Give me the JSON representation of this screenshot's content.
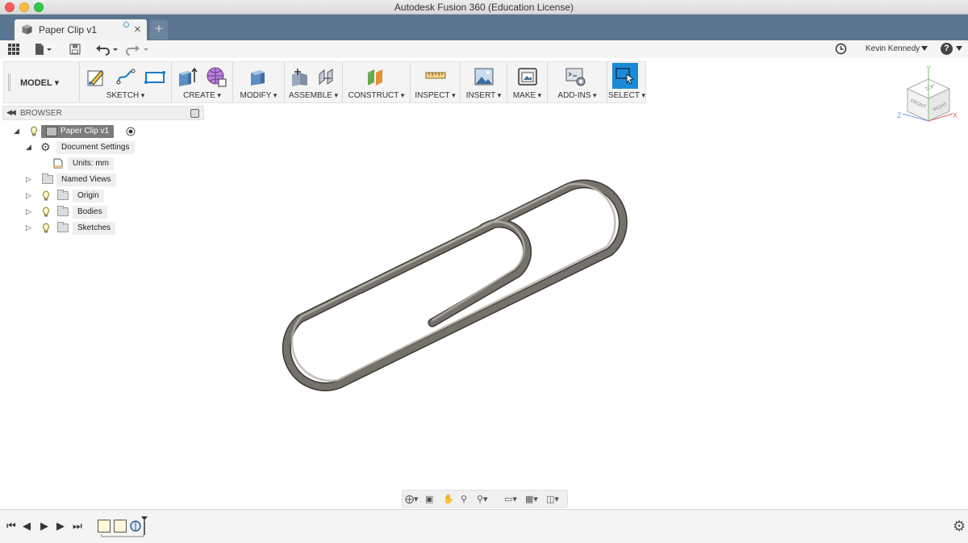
{
  "window": {
    "title": "Autodesk Fusion 360 (Education License)"
  },
  "tabs": {
    "active_label": "Paper Clip v1",
    "new_tab_symbol": "+",
    "close_symbol": "×"
  },
  "user": {
    "name": "Kevin Kennedy",
    "help": "?"
  },
  "workspace": {
    "label": "MODEL"
  },
  "toolbar": {
    "groups": [
      "SKETCH",
      "CREATE",
      "MODIFY",
      "ASSEMBLE",
      "CONSTRUCT",
      "INSPECT",
      "INSERT",
      "MAKE",
      "ADD-INS",
      "SELECT"
    ]
  },
  "browser": {
    "title": "BROWSER",
    "root": "Paper Clip v1",
    "items": [
      {
        "label": "Document Settings"
      },
      {
        "label": "Units: mm"
      },
      {
        "label": "Named Views"
      },
      {
        "label": "Origin"
      },
      {
        "label": "Bodies"
      },
      {
        "label": "Sketches"
      }
    ]
  },
  "viewcube": {
    "top": "TOP",
    "front": "FRONT",
    "right": "RIGHT",
    "x": "X",
    "y": "Y",
    "z": "Z"
  },
  "colors": {
    "tab_bar": "#5a7590",
    "select_accent": "#1a8ad6",
    "clip_metal": "#74706a"
  }
}
